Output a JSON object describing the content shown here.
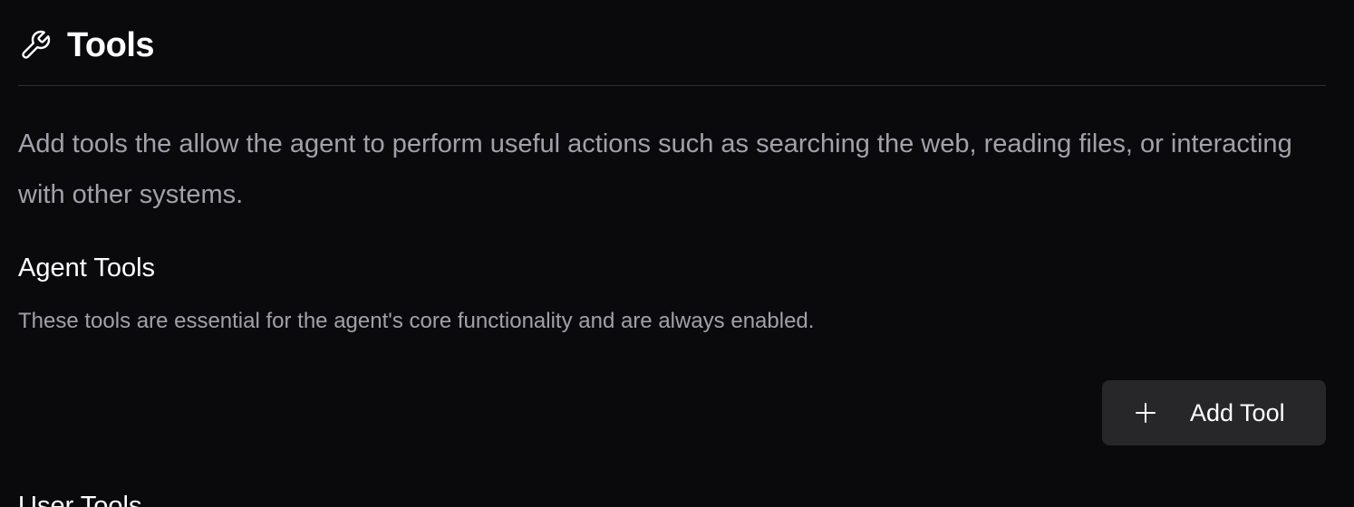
{
  "header": {
    "icon": "wrench-icon",
    "title": "Tools"
  },
  "description": "Add tools the allow the agent to perform useful actions such as searching the web, reading files, or interacting with other systems.",
  "agent_tools": {
    "title": "Agent Tools",
    "subtitle": "These tools are essential for the agent's core functionality and are always enabled.",
    "add_button": {
      "icon": "plus-icon",
      "label": "Add Tool"
    }
  },
  "user_tools": {
    "title": "User Tools"
  },
  "colors": {
    "background": "#0a0a0c",
    "muted_text": "#a1a1aa",
    "button_bg": "#27272a",
    "divider": "#2e2e33"
  }
}
